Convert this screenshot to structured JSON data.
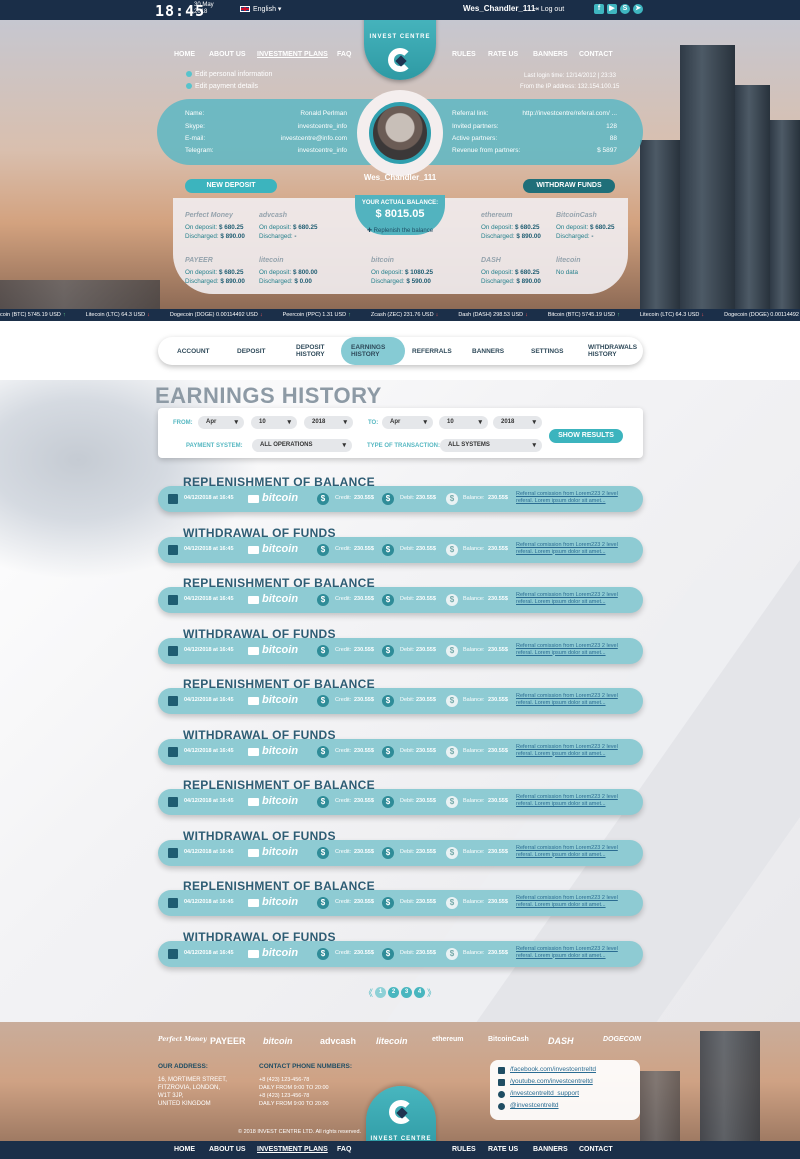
{
  "topbar": {
    "time": "18:45",
    "date": "30 May 2018",
    "language": "English ▾",
    "username": "Wes_Chandler_111",
    "logout": "Log out",
    "social": [
      {
        "icon": "facebook-icon",
        "glyph": "f"
      },
      {
        "icon": "youtube-icon",
        "glyph": "▶"
      },
      {
        "icon": "skype-icon",
        "glyph": "S"
      },
      {
        "icon": "telegram-icon",
        "glyph": "➤"
      }
    ]
  },
  "nav": {
    "left": [
      "HOME",
      "ABOUT US",
      "INVESTMENT PLANS",
      "FAQ"
    ],
    "right": [
      "RULES",
      "RATE US",
      "BANNERS",
      "CONTACT"
    ],
    "active": "INVESTMENT PLANS"
  },
  "logo": {
    "text": "INVEST CENTRE"
  },
  "profile": {
    "edit_links": [
      "Edit personal information",
      "Edit payment details"
    ],
    "last_login": "Last login time: 12/14/2012 | 23:33",
    "from_ip": "From the IP address: 132.154.100.15",
    "left": [
      {
        "label": "Name:",
        "value": "Ronald Perlman"
      },
      {
        "label": "Skype:",
        "value": "investcentre_info"
      },
      {
        "label": "E-mail:",
        "value": "investcentre@info.com"
      },
      {
        "label": "Telegram:",
        "value": "investcentre_info"
      }
    ],
    "right": [
      {
        "label": "Referral link:",
        "value": "http://investcentre/referal.com/ ..."
      },
      {
        "label": "Invited partners:",
        "value": "128"
      },
      {
        "label": "Active partners:",
        "value": "88"
      },
      {
        "label": "Revenue from partners:",
        "value": "$ 5897"
      }
    ],
    "username": "Wes_Chandler_111",
    "new_deposit": "NEW DEPOSIT",
    "withdraw": "WITHDRAW FUNDS",
    "balance_label": "YOUR ACTUAL BALANCE:",
    "balance": "$ 8015.05",
    "replenish": "Replenish the balance"
  },
  "wallets": [
    {
      "name": "Perfect Money",
      "deposit": "$ 680.25",
      "discharged": "$ 890.00"
    },
    {
      "name": "advcash",
      "deposit": "$ 680.25",
      "discharged": "-"
    },
    {
      "name": "ethereum",
      "deposit": "$ 680.25",
      "discharged": "$ 890.00"
    },
    {
      "name": "BitcoinCash",
      "deposit": "$ 680.25",
      "discharged": "-"
    },
    {
      "name": "PAYEER",
      "deposit": "$ 680.25",
      "discharged": "$ 890.00"
    },
    {
      "name": "litecoin",
      "deposit": "$ 800.00",
      "discharged": "$ 0.00"
    },
    {
      "name": "bitcoin",
      "deposit": "$ 1080.25",
      "discharged": "$ 590.00"
    },
    {
      "name": "DASH",
      "deposit": "$ 680.25",
      "discharged": "$ 890.00"
    },
    {
      "name": "litecoin",
      "deposit": "",
      "discharged": "",
      "nodata": "No data"
    }
  ],
  "wallet_labels": {
    "deposit": "On deposit:",
    "discharged": "Discharged:"
  },
  "ticker": [
    {
      "t": "coin (BTC) 5745.19 USD",
      "d": "up"
    },
    {
      "t": "Litecoin (LTC) 64.3 USD",
      "d": "dn"
    },
    {
      "t": "Dogecoin (DOGE) 0.00114492 USD",
      "d": "dn"
    },
    {
      "t": "Peercoin (PPC) 1.31 USD",
      "d": "up"
    },
    {
      "t": "Zcash (ZEC) 231.76 USD",
      "d": "dn"
    },
    {
      "t": "Dash (DASH) 298.53 USD",
      "d": "dn"
    },
    {
      "t": "Bitcoin (BTC) 5745.19 USD",
      "d": "up"
    },
    {
      "t": "Litecoin (LTC) 64.3 USD",
      "d": "dn"
    },
    {
      "t": "Dogecoin (DOGE) 0.00114492 USD",
      "d": "dn"
    },
    {
      "t": "Peercoin (PPC) 1.31 USD",
      "d": "up"
    },
    {
      "t": "Zcash (ZEC",
      "d": ""
    }
  ],
  "tabs": [
    {
      "label": "ACCOUNT"
    },
    {
      "label": "DEPOSIT"
    },
    {
      "label": "DEPOSIT HISTORY"
    },
    {
      "label": "EARNINGS HISTORY",
      "active": true
    },
    {
      "label": "REFERRALS"
    },
    {
      "label": "BANNERS"
    },
    {
      "label": "SETTINGS"
    },
    {
      "label": "WITHDRAWALS HISTORY"
    }
  ],
  "page_title": "EARNINGS HISTORY",
  "filter": {
    "from": "FROM:",
    "to": "TO:",
    "month1": "Apr",
    "day1": "10",
    "year1": "2018",
    "month2": "Apr",
    "day2": "10",
    "year2": "2018",
    "payment_label": "PAYMENT SYSTEM:",
    "payment_value": "ALL OPERATIONS",
    "type_label": "TYPE OF TRANSACTION:",
    "type_value": "ALL SYSTEMS",
    "show": "SHOW RESULTS"
  },
  "row_labels": {
    "credit": "Credit:",
    "debit": "Debit:",
    "balance": "Balance:"
  },
  "records": [
    {
      "title": "REPLENISHMENT OF BALANCE",
      "date": "04/12/2018 at 16:45",
      "system": "bitcoin",
      "credit": "230.55$",
      "debit": "230.55$",
      "balance": "230.55$",
      "note": "Referral comission from Lorem223 2 level referal. Lorem ipsum dolor sit amet..."
    },
    {
      "title": "WITHDRAWAL OF FUNDS",
      "date": "04/12/2018 at 16:45",
      "system": "bitcoin",
      "credit": "230.55$",
      "debit": "230.55$",
      "balance": "230.55$",
      "note": "Referral comission from Lorem223 2 level referal. Lorem ipsum dolor sit amet..."
    },
    {
      "title": "REPLENISHMENT OF BALANCE",
      "date": "04/12/2018 at 16:45",
      "system": "bitcoin",
      "credit": "230.55$",
      "debit": "230.55$",
      "balance": "230.55$",
      "note": "Referral comission from Lorem223 2 level referal. Lorem ipsum dolor sit amet..."
    },
    {
      "title": "WITHDRAWAL OF FUNDS",
      "date": "04/12/2018 at 16:45",
      "system": "bitcoin",
      "credit": "230.55$",
      "debit": "230.55$",
      "balance": "230.55$",
      "note": "Referral comission from Lorem223 2 level referal. Lorem ipsum dolor sit amet..."
    },
    {
      "title": "REPLENISHMENT OF BALANCE",
      "date": "04/12/2018 at 16:45",
      "system": "bitcoin",
      "credit": "230.55$",
      "debit": "230.55$",
      "balance": "230.55$",
      "note": "Referral comission from Lorem223 2 level referal. Lorem ipsum dolor sit amet..."
    },
    {
      "title": "WITHDRAWAL OF FUNDS",
      "date": "04/12/2018 at 16:45",
      "system": "bitcoin",
      "credit": "230.55$",
      "debit": "230.55$",
      "balance": "230.55$",
      "note": "Referral comission from Lorem223 2 level referal. Lorem ipsum dolor sit amet..."
    },
    {
      "title": "REPLENISHMENT OF BALANCE",
      "date": "04/12/2018 at 16:45",
      "system": "bitcoin",
      "credit": "230.55$",
      "debit": "230.55$",
      "balance": "230.55$",
      "note": "Referral comission from Lorem223 2 level referal. Lorem ipsum dolor sit amet..."
    },
    {
      "title": "WITHDRAWAL OF FUNDS",
      "date": "04/12/2018 at 16:45",
      "system": "bitcoin",
      "credit": "230.55$",
      "debit": "230.55$",
      "balance": "230.55$",
      "note": "Referral comission from Lorem223 2 level referal. Lorem ipsum dolor sit amet..."
    },
    {
      "title": "REPLENISHMENT OF BALANCE",
      "date": "04/12/2018 at 16:45",
      "system": "bitcoin",
      "credit": "230.55$",
      "debit": "230.55$",
      "balance": "230.55$",
      "note": "Referral comission from Lorem223 2 level referal. Lorem ipsum dolor sit amet..."
    },
    {
      "title": "WITHDRAWAL OF FUNDS",
      "date": "04/12/2018 at 16:45",
      "system": "bitcoin",
      "credit": "230.55$",
      "debit": "230.55$",
      "balance": "230.55$",
      "note": "Referral comission from Lorem223 2 level referal. Lorem ipsum dolor sit amet..."
    }
  ],
  "pagination": {
    "prev": "《",
    "next": "》",
    "pages": [
      "1",
      "2",
      "3",
      "4"
    ],
    "current": "1"
  },
  "footer": {
    "payment_logos": [
      "Perfect Money",
      "PAYEER",
      "bitcoin",
      "advcash",
      "litecoin",
      "ethereum",
      "BitcoinCash",
      "DASH",
      "DOGECOIN"
    ],
    "address_title": "OUR ADDRESS:",
    "address": [
      "16, MORTIMER STREET,",
      "FITZROVIA, LONDON,",
      "W1T 3JP,",
      "UNITED KINGDOM"
    ],
    "phone_title": "CONTACT PHONE NUMBERS:",
    "phones": [
      "+8 (423) 123-456-78",
      "DAILY FROM 9:00 TO 20:00",
      "+8 (423) 123-456-78",
      "DAILY FROM 9:00 TO 20:00"
    ],
    "social_links": [
      "/facebook.com/investcentreltd",
      "/youtube.com/investcentreltd",
      "/investcentreltd_support",
      "@investcentreltd"
    ],
    "copyright": "© 2018 INVEST CENTRE LTD. All rights reserved.",
    "nav_left": [
      "HOME",
      "ABOUT US",
      "INVESTMENT PLANS",
      "FAQ"
    ],
    "nav_right": [
      "RULES",
      "RATE US",
      "BANNERS",
      "CONTACT"
    ]
  },
  "colors": {
    "accent": "#3cb4be",
    "navy": "#1b2f49",
    "row": "#8ecbd3"
  }
}
